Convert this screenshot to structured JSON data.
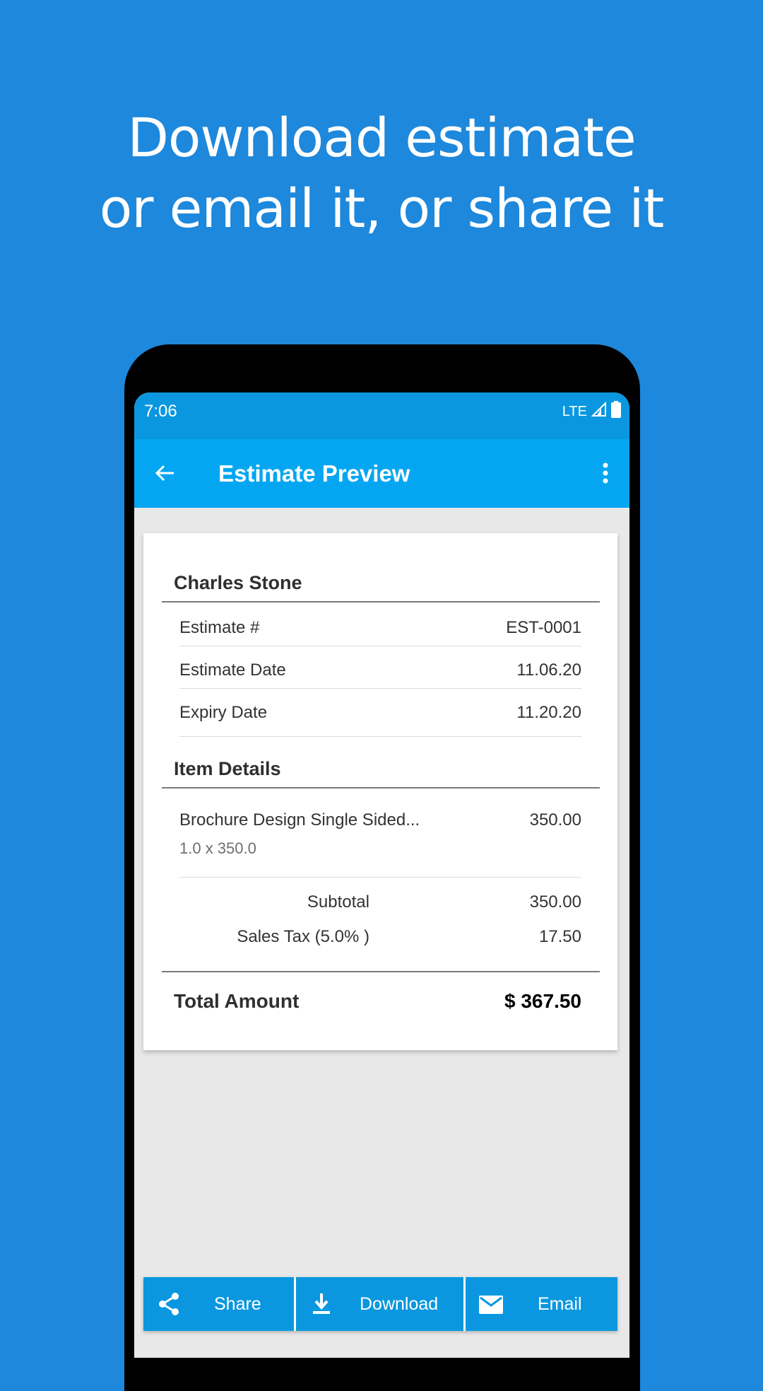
{
  "headline": {
    "line1": "Download estimate",
    "line2": "or email it, or share it"
  },
  "status_bar": {
    "time": "7:06",
    "network": "LTE",
    "icons": [
      "signal-icon",
      "battery-icon"
    ]
  },
  "app_bar": {
    "title": "Estimate Preview",
    "icons": [
      "back-arrow-icon",
      "more-vert-icon"
    ]
  },
  "estimate": {
    "customer": "Charles Stone",
    "fields": [
      {
        "label": "Estimate #",
        "value": "EST-0001"
      },
      {
        "label": "Estimate Date",
        "value": "11.06.20"
      },
      {
        "label": "Expiry Date",
        "value": "11.20.20"
      }
    ],
    "item_details_title": "Item Details",
    "items": [
      {
        "name": "Brochure Design Single Sided...",
        "qty_rate": "1.0 x 350.0",
        "amount": "350.00"
      }
    ],
    "subtotal": {
      "label": "Subtotal",
      "value": "350.00"
    },
    "tax": {
      "label": "Sales Tax (5.0% )",
      "value": "17.50"
    },
    "total": {
      "label": "Total Amount",
      "value": "$ 367.50"
    }
  },
  "actions": [
    {
      "label": "Share",
      "icon": "share-icon"
    },
    {
      "label": "Download",
      "icon": "download-icon"
    },
    {
      "label": "Email",
      "icon": "email-icon"
    }
  ],
  "colors": {
    "page_background": "#1d88dc",
    "status_bar": "#0a97e0",
    "app_bar": "#04a6f2",
    "action_button": "#0a97e0"
  }
}
